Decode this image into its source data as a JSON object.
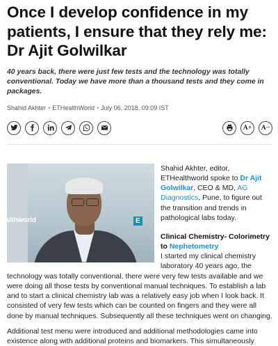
{
  "article": {
    "headline": "Once I develop confidence in my patients, I ensure that they rely me: Dr Ajit Golwilkar",
    "summary": "40 years back, there were just few tests and the technology was totally conventional. Today we have more than a thousand tests and they come in packages.",
    "author": "Shahid Akhter",
    "publication": "ETHealthWorld",
    "date": "July 06, 2018, 09:09 IST"
  },
  "share": {
    "icons": [
      "twitter-icon",
      "facebook-icon",
      "linkedin-icon",
      "telegram-icon",
      "whatsapp-icon",
      "email-icon"
    ]
  },
  "tools": {
    "print_icon": "print-icon",
    "font_increase": "A+",
    "font_decrease": "A−"
  },
  "photo": {
    "brand_left": "ealthworld",
    "brand_right": "E"
  },
  "intro": {
    "part1": "Shahid Akhter, editor, ETHealthworld spoke to ",
    "link_name": "Dr Ajit Golwilkar",
    "part2": ", CEO & MD, ",
    "link_company": "AG Diagnostics",
    "part3": ", Pune, to figure out the transition and trends in pathological labs today."
  },
  "subhead": {
    "text": "Clinical Chemistry- Colorimetry to ",
    "link": "Nephetometry"
  },
  "paragraph1_start": "I started my clinical chemistry laboratory 40 years ago, the",
  "paragraph1_rest": "technology was totally conventional, there were very few tests available and we were doing all those tests by conventional manual techniques. To establish a lab and to start a clinical chemistry lab was a relatively easy job when I look back. It consisted of very few tests which can be counted on fingers and they were all done by manual techniques. Subsequently all these techniques went on changing.",
  "paragraph2": "Additional test menu were introduced and additional methodologies came into existence along with additional proteins and biomarkers. This simultaneously"
}
